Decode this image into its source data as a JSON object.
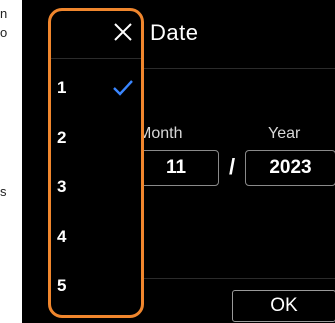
{
  "background_fragments": [
    "n",
    "o",
    "s"
  ],
  "dialog": {
    "title": "Date",
    "month_label": "Month",
    "year_label": "Year",
    "month_value": "11",
    "separator": "/",
    "year_value": "2023",
    "ok_label": "OK"
  },
  "dropdown": {
    "close_icon": "close-icon",
    "selected": "1",
    "items": [
      {
        "label": "1",
        "checked": true
      },
      {
        "label": "2",
        "checked": false
      },
      {
        "label": "3",
        "checked": false
      },
      {
        "label": "4",
        "checked": false
      },
      {
        "label": "5",
        "checked": false
      }
    ]
  },
  "colors": {
    "highlight_border": "#f0862d",
    "check": "#3a86ff",
    "screen_bg": "#000000"
  }
}
